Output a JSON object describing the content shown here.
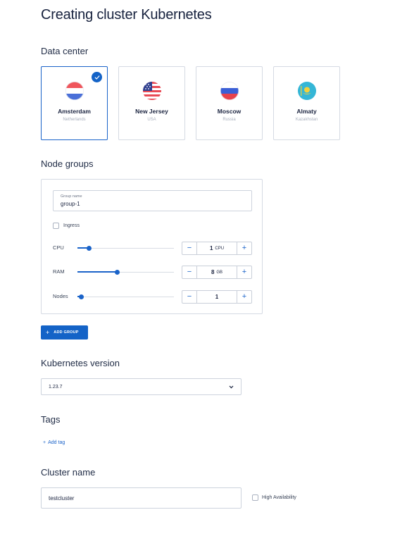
{
  "page": {
    "title": "Creating cluster Kubernetes"
  },
  "colors": {
    "accent": "#1463c7",
    "border": "#d5dae3",
    "text": "#1b2440"
  },
  "data_center": {
    "title": "Data center",
    "locations": [
      {
        "name": "Amsterdam",
        "country": "Netherlands",
        "flag": "netherlands-flag-icon",
        "selected": true
      },
      {
        "name": "New Jersey",
        "country": "USA",
        "flag": "usa-flag-icon",
        "selected": false
      },
      {
        "name": "Moscow",
        "country": "Russia",
        "flag": "russia-flag-icon",
        "selected": false
      },
      {
        "name": "Almaty",
        "country": "Kazakhstan",
        "flag": "kazakhstan-flag-icon",
        "selected": false
      }
    ]
  },
  "node_groups": {
    "title": "Node groups",
    "group_name_label": "Group name",
    "group_name_value": "group-1",
    "ingress_label": "Ingress",
    "ingress_checked": false,
    "resources": [
      {
        "label": "CPU",
        "value": "1",
        "unit": "CPU",
        "slider_fraction": 0.12
      },
      {
        "label": "RAM",
        "value": "8",
        "unit": "GB",
        "slider_fraction": 0.41
      },
      {
        "label": "Nodes",
        "value": "1",
        "unit": "",
        "slider_fraction": 0.04
      }
    ],
    "minus_symbol": "−",
    "plus_symbol": "+"
  },
  "add_group": {
    "icon": "+",
    "label": "ADD GROUP"
  },
  "k8s_version": {
    "title": "Kubernetes version",
    "selected": "1.23.7"
  },
  "tags": {
    "title": "Tags",
    "add_icon": "+",
    "add_label": "Add tag"
  },
  "cluster_name": {
    "title": "Cluster name",
    "value": "testcluster",
    "ha_label": "High Availability",
    "ha_checked": false
  }
}
